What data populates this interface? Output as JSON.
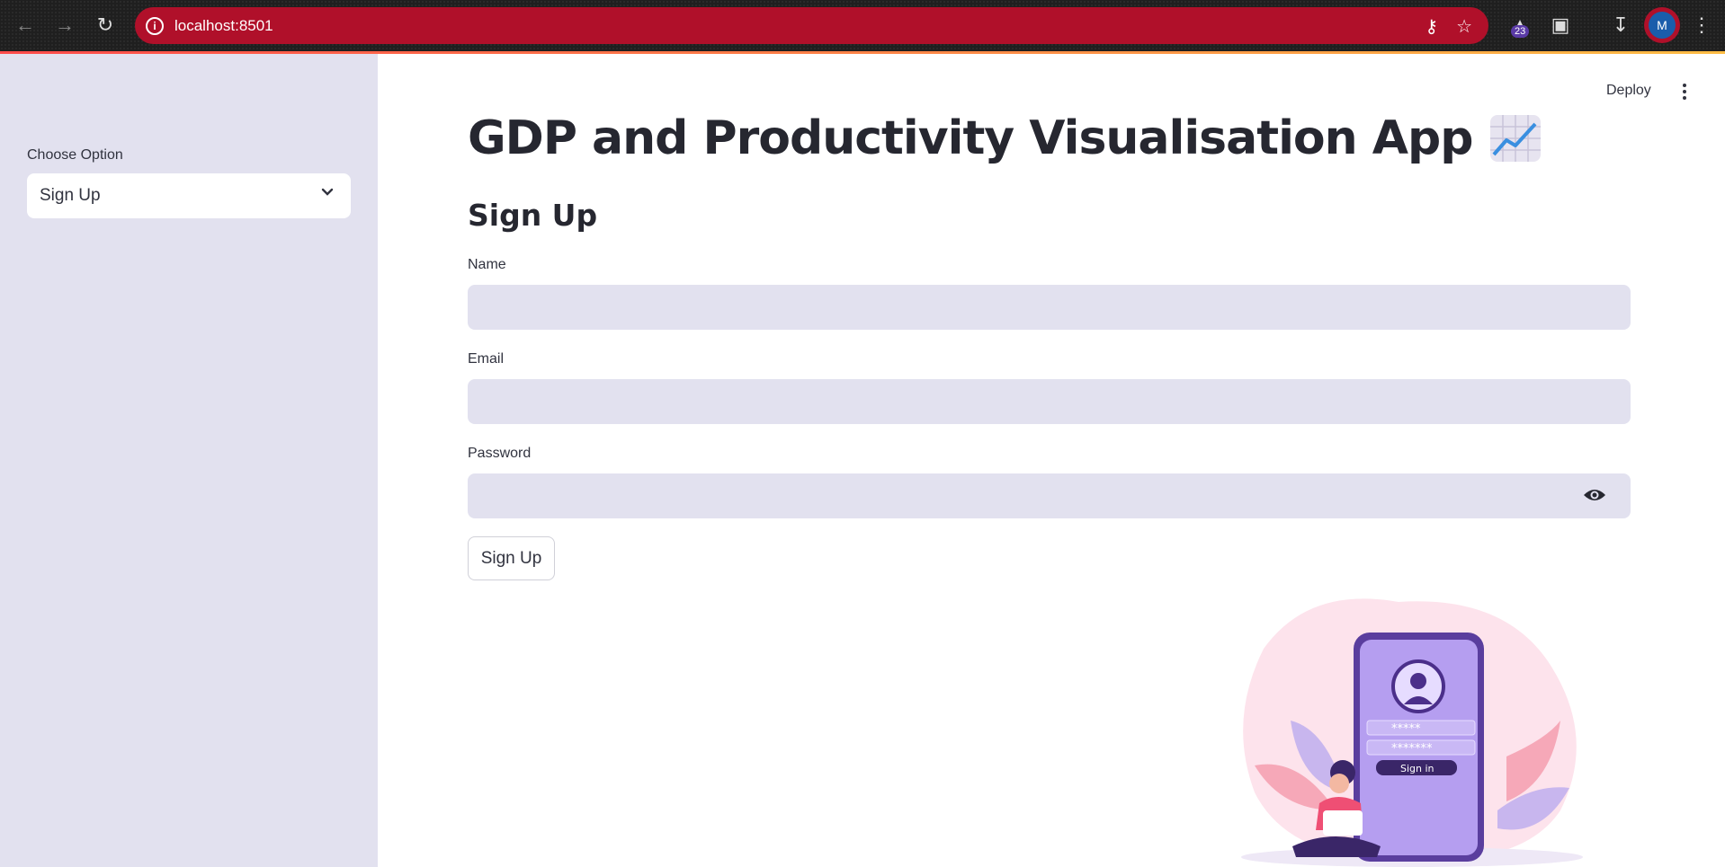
{
  "browser": {
    "url": "localhost:8501",
    "extension_badge": "23",
    "profile_initial": "M",
    "accent": "#b0102a"
  },
  "header": {
    "deploy_label": "Deploy"
  },
  "sidebar": {
    "select_label": "Choose Option",
    "select_value": "Sign Up"
  },
  "main": {
    "title": "GDP and Productivity Visualisation App",
    "title_icon": "chart-increasing-emoji",
    "subtitle": "Sign Up",
    "fields": [
      {
        "label": "Name",
        "value": ""
      },
      {
        "label": "Email",
        "value": ""
      },
      {
        "label": "Password",
        "value": ""
      }
    ],
    "submit_label": "Sign Up"
  },
  "illustration": {
    "password_mask_1": "*****",
    "password_mask_2": "*******",
    "button_text": "Sign in"
  }
}
